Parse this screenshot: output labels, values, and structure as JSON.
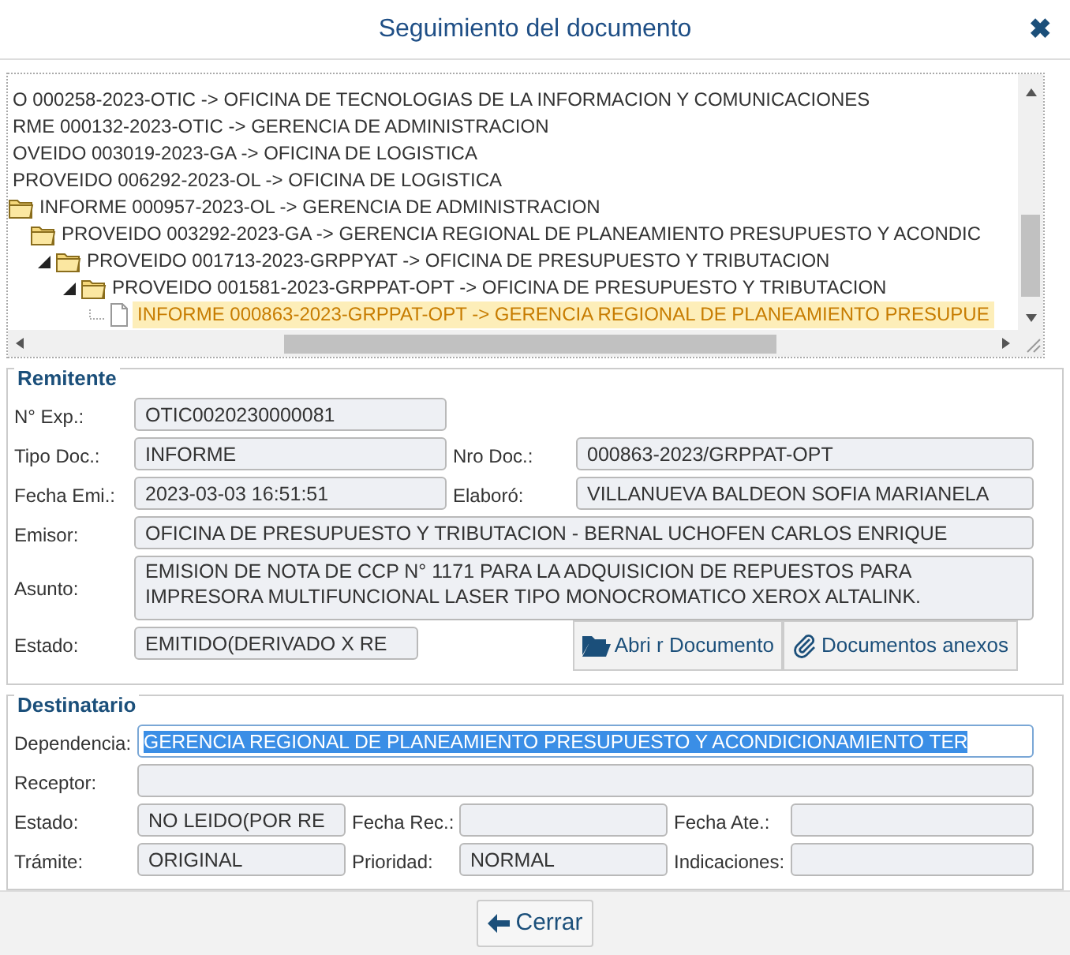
{
  "window": {
    "title": "Seguimiento del documento",
    "close": "✖"
  },
  "tree": [
    {
      "label": "O 000258-2023-OTIC -> OFICINA DE TECNOLOGIAS DE LA INFORMACION Y COMUNICACIONES",
      "selected": false,
      "children": [
        {
          "label": "RME 000132-2023-OTIC -> GERENCIA DE ADMINISTRACION",
          "selected": false,
          "children": [
            {
              "label": "OVEIDO 003019-2023-GA -> OFICINA DE LOGISTICA",
              "selected": false,
              "children": [
                {
                  "label": "PROVEIDO 006292-2023-OL -> OFICINA DE LOGISTICA",
                  "selected": false,
                  "children": [
                    {
                      "label": "INFORME 000957-2023-OL -> GERENCIA DE ADMINISTRACION",
                      "kind": "folder",
                      "selected": false,
                      "children": [
                        {
                          "label": "PROVEIDO 003292-2023-GA -> GERENCIA REGIONAL DE PLANEAMIENTO PRESUPUESTO Y ACONDIC",
                          "kind": "folder",
                          "selected": false,
                          "children": [
                            {
                              "label": "PROVEIDO 001713-2023-GRPPYAT -> OFICINA DE PRESUPUESTO Y TRIBUTACION",
                              "kind": "folder",
                              "selected": false,
                              "expanded": true,
                              "children": [
                                {
                                  "label": "PROVEIDO 001581-2023-GRPPAT-OPT -> OFICINA DE PRESUPUESTO Y TRIBUTACION",
                                  "kind": "folder",
                                  "selected": false,
                                  "expanded": true,
                                  "children": [
                                    {
                                      "label": "INFORME 000863-2023-GRPPAT-OPT -> GERENCIA REGIONAL DE PLANEAMIENTO PRESUPUE",
                                      "kind": "document",
                                      "selected": true
                                    }
                                  ]
                                }
                              ]
                            }
                          ]
                        }
                      ]
                    }
                  ]
                }
              ]
            }
          ]
        }
      ]
    }
  ],
  "remitente": {
    "legend": "Remitente",
    "rows": [
      {
        "fields": [
          {
            "label": "N° Exp.:",
            "value": "OTIC0020230000081"
          }
        ]
      },
      {
        "fields": [
          {
            "label": "Tipo Doc.:",
            "value": "INFORME"
          },
          {
            "label": "Nro Doc.:",
            "value": "000863-2023/GRPPAT-OPT"
          }
        ]
      },
      {
        "fields": [
          {
            "label": "Fecha Emi.:",
            "value": "2023-03-03 16:51:51"
          },
          {
            "label": "Elaboró:",
            "value": "VILLANUEVA BALDEON SOFIA MARIANELA"
          }
        ]
      },
      {
        "fields": [
          {
            "label": "Emisor:",
            "value": "OFICINA DE PRESUPUESTO Y TRIBUTACION - BERNAL UCHOFEN CARLOS ENRIQUE"
          }
        ]
      },
      {
        "fields": [
          {
            "label": "Asunto:",
            "kind": "textarea",
            "value": "EMISION DE NOTA DE CCP  N° 1171 PARA LA ADQUISICION DE REPUESTOS PARA IMPRESORA MULTIFUNCIONAL LASER TIPO MONOCROMATICO XEROX ALTALINK."
          }
        ]
      },
      {
        "fields": [
          {
            "label": "Estado:",
            "value": "EMITIDO(DERIVADO X RE"
          }
        ],
        "buttons": [
          {
            "label": "Abri r Documento",
            "kind": "open"
          },
          {
            "label": "Documentos anexos",
            "kind": "attachments"
          }
        ]
      }
    ]
  },
  "destinatario": {
    "legend": "Destinatario",
    "rows": [
      {
        "fields": [
          {
            "label": "Dependencia:",
            "value": "GERENCIA REGIONAL DE PLANEAMIENTO PRESUPUESTO Y ACONDICIONAMIENTO TER",
            "highlighted": true
          }
        ]
      },
      {
        "fields": [
          {
            "label": "Receptor:"
          }
        ]
      },
      {
        "fields": [
          {
            "label": "Estado:",
            "value": "NO LEIDO(POR RE"
          },
          {
            "label": "Fecha Rec.:"
          },
          {
            "label": "Fecha Ate.:"
          }
        ]
      },
      {
        "fields": [
          {
            "label": "Trámite:",
            "value": "ORIGINAL"
          },
          {
            "label": "Prioridad:",
            "value": "NORMAL"
          },
          {
            "label": "Indicaciones:"
          }
        ]
      }
    ]
  },
  "footer": {
    "button": "Cerrar"
  }
}
